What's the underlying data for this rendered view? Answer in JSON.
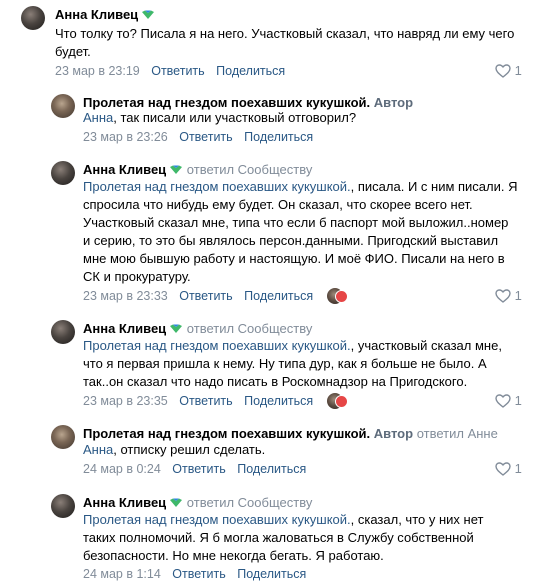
{
  "colors": {
    "link": "#2a5885",
    "meta": "#818c99",
    "heart": "#e64646",
    "badge": "#3fb86a"
  },
  "comments": [
    {
      "name": "Анна Кливец",
      "text": "Что толку то? Писала я на него. Участковый сказал, что навряд ли ему чего будет.",
      "date": "23 мар в 23:19",
      "reply": "Ответить",
      "share": "Поделиться",
      "likes": "1"
    },
    {
      "name": "Пролетая над гнездом поехавших кукушкой.",
      "author_tag": "Автор",
      "mention": "Анна",
      "text": ", так писали или участковый отговорил?",
      "date": "23 мар в 23:26",
      "reply": "Ответить",
      "share": "Поделиться"
    },
    {
      "name": "Анна Кливец",
      "replied": "ответил Сообществу",
      "mention": "Пролетая над гнездом поехавших кукушкой.",
      "text_lines": [
        ", писала. И с ним писали. Я",
        "спросила что нибудь ему будет. Он сказал, что скорее всего нет.",
        "Участковый сказал мне, типа что если б паспорт мой выложил..номер",
        "и серию, то это бы являлось персон.данными. Пригодский выставил",
        "мне мою бывшую работу и настоящую. И моё ФИО. Писали на него в",
        "СК и прокуратуру."
      ],
      "date": "23 мар в 23:33",
      "reply": "Ответить",
      "share": "Поделиться",
      "likes": "1"
    },
    {
      "name": "Анна Кливец",
      "replied": "ответил Сообществу",
      "mention": "Пролетая над гнездом поехавших кукушкой.",
      "text_lines": [
        ", участковый сказал мне,",
        "что я первая пришла к нему. Ну типа дур, как я больше не было. А",
        "так..он сказал что надо писать в Роскомнадзор на Пригодского."
      ],
      "date": "23 мар в 23:35",
      "reply": "Ответить",
      "share": "Поделиться",
      "likes": "1"
    },
    {
      "name": "Пролетая над гнездом поехавших кукушкой.",
      "author_tag": "Автор",
      "replied": "ответил Анне",
      "mention": "Анна",
      "text": ", отписку решил сделать.",
      "date": "24 мар в 0:24",
      "reply": "Ответить",
      "share": "Поделиться",
      "likes": "1"
    },
    {
      "name": "Анна Кливец",
      "replied": "ответил Сообществу",
      "mention": "Пролетая над гнездом поехавших кукушкой.",
      "text_lines": [
        ", сказал, что у них нет",
        "таких полномочий. Я б могла жаловаться в Службу собственной",
        "безопасности. Но мне некогда бегать. Я работаю."
      ],
      "date": "24 мар в 1:14",
      "reply": "Ответить",
      "share": "Поделиться"
    }
  ]
}
